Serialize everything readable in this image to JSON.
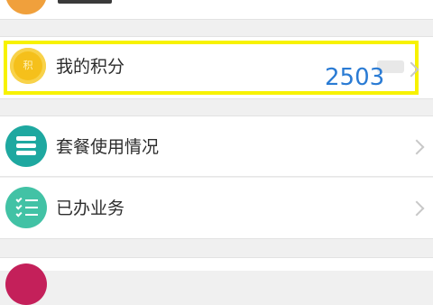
{
  "menu": {
    "points": {
      "label": "我的积分",
      "icon_char": "积",
      "value": "2503",
      "icon": "points-coin-icon"
    },
    "package_usage": {
      "label": "套餐使用情况",
      "icon": "usage-stack-icon"
    },
    "done_business": {
      "label": "已办业务",
      "icon": "checklist-icon"
    }
  },
  "colors": {
    "highlight": "#f7f200",
    "value_text": "#2a7bd4",
    "usage_icon": "#1ea8a0",
    "business_icon": "#42c2a5",
    "points_icon": "#f5c01b",
    "top_icon": "#f0a03c",
    "bottom_icon": "#c4205a"
  }
}
